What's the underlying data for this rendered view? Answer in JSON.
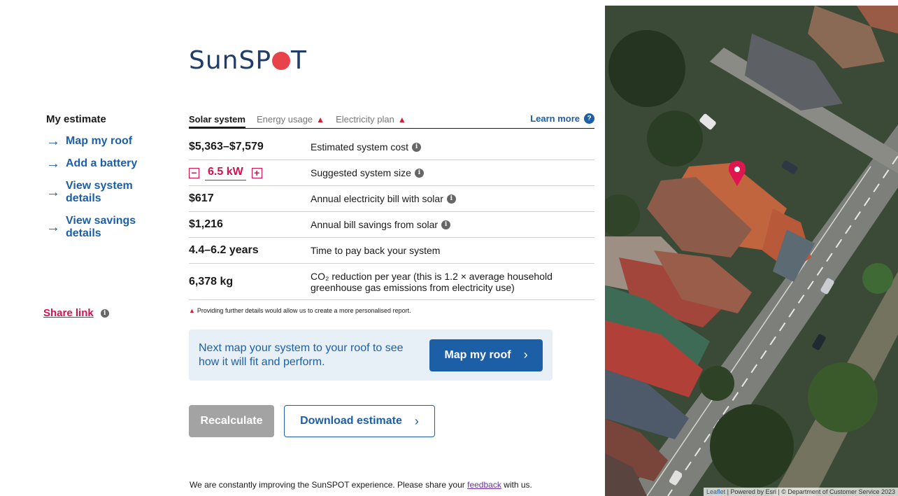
{
  "logo": {
    "prefix": "SunSP",
    "suffix": "T"
  },
  "nav": {
    "title": "My estimate",
    "items": [
      {
        "label": "Map my roof"
      },
      {
        "label": "Add a battery"
      },
      {
        "label": "View system details"
      },
      {
        "label": "View savings details"
      }
    ],
    "share_label": "Share link"
  },
  "tabs": [
    {
      "label": "Solar system",
      "active": true
    },
    {
      "label": "Energy usage",
      "warning": true
    },
    {
      "label": "Electricity plan",
      "warning": true
    }
  ],
  "learn_more": "Learn more",
  "rows": [
    {
      "value": "$5,363–$7,579",
      "label": "Estimated system cost",
      "info": true
    },
    {
      "value": "6.5 kW",
      "label": "Suggested system size",
      "info": true,
      "stepper": true
    },
    {
      "value": "$617",
      "label": "Annual electricity bill with solar",
      "info": true
    },
    {
      "value": "$1,216",
      "label": "Annual bill savings from solar",
      "info": true
    },
    {
      "value": "4.4–6.2 years",
      "label": "Time to pay back your system"
    },
    {
      "value": "6,378 kg",
      "label_line1": "CO₂ reduction per year (this is 1.2 × average household",
      "label_line2": "greenhouse gas emissions from electricity use)"
    }
  ],
  "notice": "Providing further details would allow us to create a more personalised report.",
  "cta": {
    "text": "Next map your system to your roof to see how it will fit and perform.",
    "button": "Map my roof"
  },
  "actions": {
    "recalculate": "Recalculate",
    "download": "Download estimate"
  },
  "footer": {
    "before": "We are constantly improving the SunSPOT experience. Please share your ",
    "link": "feedback",
    "after": " with us."
  },
  "map": {
    "attribution_link": "Leaflet",
    "attribution_text": " | Powered by Esri | © Department of Customer Service 2023"
  },
  "colors": {
    "brand_blue": "#1d5fa6",
    "accent_red": "#d5124d",
    "logo_navy": "#1f3d68",
    "logo_dot": "#e8434a"
  }
}
